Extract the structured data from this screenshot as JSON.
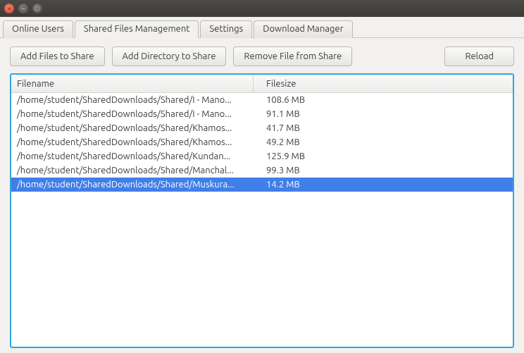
{
  "tabs": {
    "online_users": "Online Users",
    "shared_files": "Shared Files Management",
    "settings": "Settings",
    "download_manager": "Download Manager"
  },
  "toolbar": {
    "add_files": "Add Files to Share",
    "add_directory": "Add Directory to Share",
    "remove_file": "Remove File from Share",
    "reload": "Reload"
  },
  "table": {
    "headers": {
      "filename": "Filename",
      "filesize": "Filesize"
    },
    "rows": [
      {
        "filename": "/home/student/SharedDownloads/Shared/I - Mano...",
        "filesize": "108.6 MB",
        "selected": false
      },
      {
        "filename": "/home/student/SharedDownloads/Shared/I - Mano...",
        "filesize": "91.1 MB",
        "selected": false
      },
      {
        "filename": "/home/student/SharedDownloads/Shared/Khamos...",
        "filesize": "41.7 MB",
        "selected": false
      },
      {
        "filename": "/home/student/SharedDownloads/Shared/Khamos...",
        "filesize": "49.2 MB",
        "selected": false
      },
      {
        "filename": "/home/student/SharedDownloads/Shared/Kundan...",
        "filesize": "125.9 MB",
        "selected": false
      },
      {
        "filename": "/home/student/SharedDownloads/Shared/Manchal...",
        "filesize": "99.3 MB",
        "selected": false
      },
      {
        "filename": "/home/student/SharedDownloads/Shared/Muskura...",
        "filesize": "14.2 MB",
        "selected": true
      }
    ]
  }
}
